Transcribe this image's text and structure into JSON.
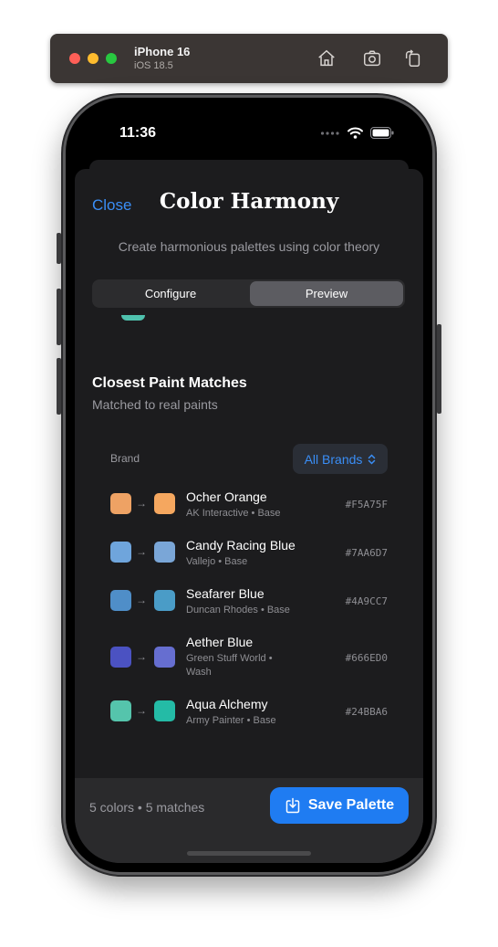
{
  "simulator": {
    "device_name": "iPhone 16",
    "os_version": "iOS 18.5",
    "buttons": [
      "home-icon",
      "screenshot-icon",
      "rotate-icon"
    ]
  },
  "status_bar": {
    "time": "11:36"
  },
  "sheet": {
    "close_label": "Close",
    "title": "Color Harmony",
    "subtitle": "Create harmonious palettes using color theory",
    "tabs": [
      {
        "label": "Configure",
        "selected": false
      },
      {
        "label": "Preview",
        "selected": true
      }
    ]
  },
  "matches": {
    "title": "Closest Paint Matches",
    "subtitle": "Matched to real paints",
    "brand_label": "Brand",
    "brand_value": "All Brands",
    "items": [
      {
        "name": "Ocher Orange",
        "meta": "AK Interactive • Base",
        "hex": "#F5A75F",
        "src_color": "#eea264",
        "dst_color": "#F5A75F"
      },
      {
        "name": "Candy Racing Blue",
        "meta": "Vallejo • Base",
        "hex": "#7AA6D7",
        "src_color": "#6fa5dc",
        "dst_color": "#7AA6D7"
      },
      {
        "name": "Seafarer Blue",
        "meta": "Duncan Rhodes • Base",
        "hex": "#4A9CC7",
        "src_color": "#4f8ec8",
        "dst_color": "#4A9CC7"
      },
      {
        "name": "Aether Blue",
        "meta": "Green Stuff World • Wash",
        "hex": "#666ED0",
        "src_color": "#4b52c2",
        "dst_color": "#666ED0"
      },
      {
        "name": "Aqua Alchemy",
        "meta": "Army Painter • Base",
        "hex": "#24BBA6",
        "src_color": "#55c4ac",
        "dst_color": "#24BBA6"
      }
    ]
  },
  "footer": {
    "summary": "5 colors • 5 matches",
    "save_label": "Save Palette"
  },
  "colors": {
    "accent": "#1f7cf2",
    "sheet_bg": "#1c1c1e",
    "peek_swatch": "#4fc1ad"
  }
}
